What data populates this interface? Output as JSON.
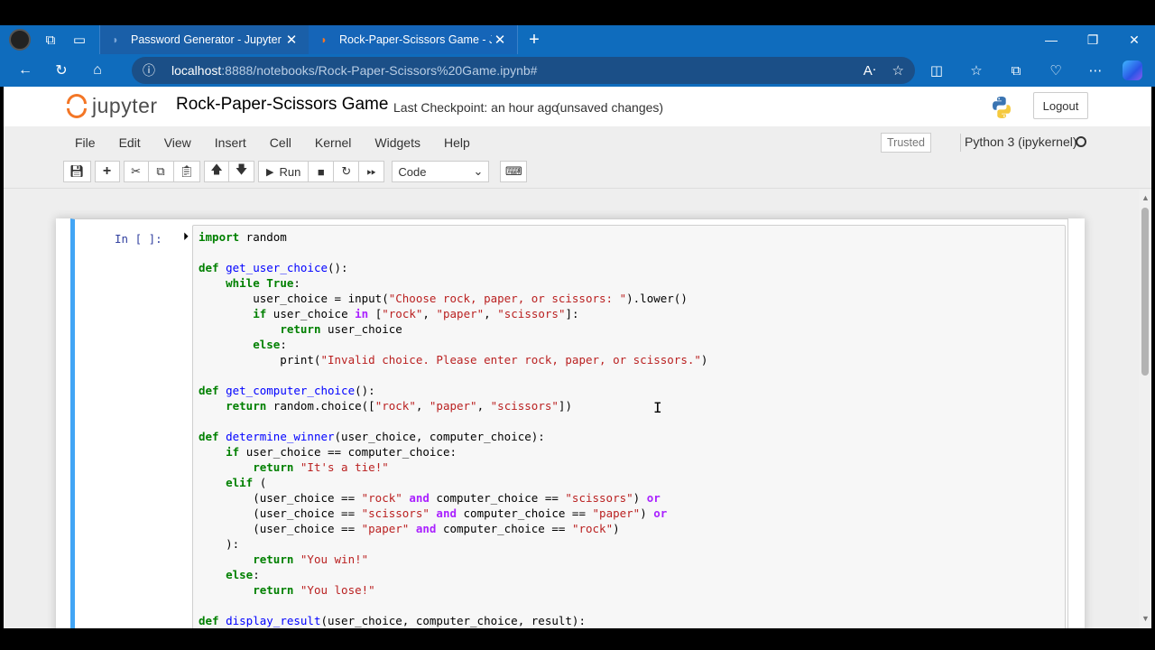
{
  "browser": {
    "tabs": [
      {
        "title": "Password Generator - Jupyter No",
        "active": false
      },
      {
        "title": "Rock-Paper-Scissors Game - Jupy",
        "active": true
      }
    ],
    "new_tab_glyph": "+",
    "url_host": "localhost",
    "url_rest": ":8888/notebooks/Rock-Paper-Scissors%20Game.ipynb#",
    "accent_color": "#0f6cbd"
  },
  "jupyter": {
    "logo_text": "jupyter",
    "notebook_title": "Rock-Paper-Scissors Game",
    "checkpoint": "Last Checkpoint: an hour ago",
    "unsaved": "(unsaved changes)",
    "logout_label": "Logout",
    "menu": [
      "File",
      "Edit",
      "View",
      "Insert",
      "Cell",
      "Kernel",
      "Widgets",
      "Help"
    ],
    "trusted_label": "Trusted",
    "kernel_name": "Python 3 (ipykernel)",
    "toolbar": {
      "run_label": "Run",
      "cell_type": "Code"
    },
    "cell": {
      "prompt": "In [ ]:"
    }
  }
}
